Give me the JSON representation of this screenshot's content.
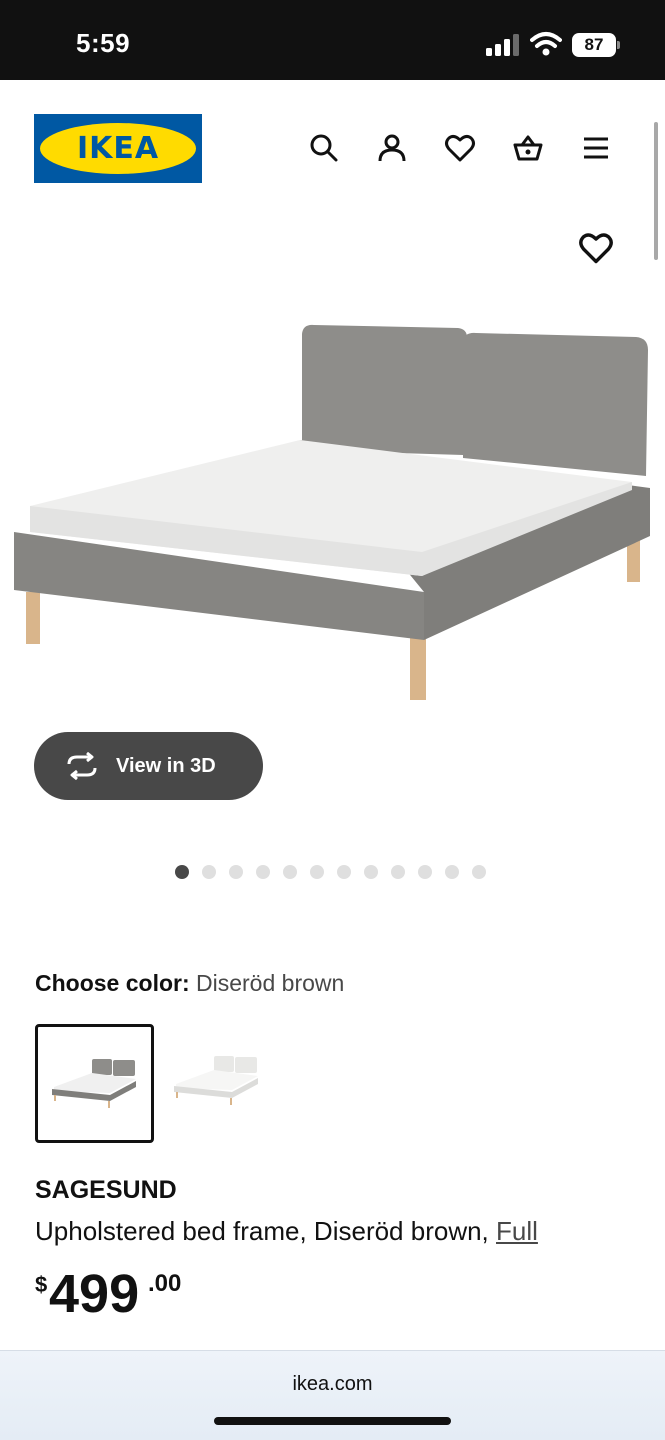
{
  "status_bar": {
    "time": "5:59",
    "battery": "87",
    "icons": [
      "signal-icon",
      "wifi-icon",
      "battery-icon"
    ]
  },
  "header": {
    "logo_text": "IKEA",
    "icons": [
      "search-icon",
      "account-icon",
      "favorites-icon",
      "basket-icon",
      "menu-icon"
    ]
  },
  "product": {
    "favorite_icon": "heart-icon",
    "view_3d_label": "View in 3D",
    "image_count": 12,
    "active_image": 1,
    "choose_color_label": "Choose color:",
    "selected_color": "Diseröd brown",
    "swatches": [
      "gray bed swatch",
      "white bed swatch"
    ],
    "name": "SAGESUND",
    "description": "Upholstered bed frame, Diseröd brown,",
    "size": "Full",
    "price": {
      "currency": "$",
      "integer": "499",
      "decimal": ".00"
    }
  },
  "browser": {
    "url": "ikea.com"
  },
  "colors": {
    "ikea_blue": "#0058a3",
    "ikea_yellow": "#ffdb00",
    "button_dark": "#484848"
  }
}
